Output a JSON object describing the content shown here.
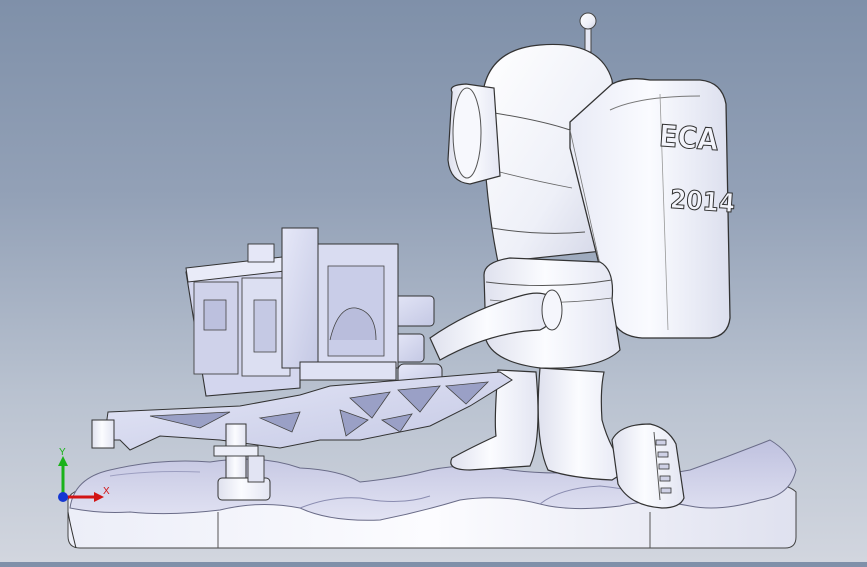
{
  "scene": {
    "backpack_text_top": "ECA",
    "backpack_text_bottom": "2014"
  },
  "triad": {
    "y_label": "Y",
    "x_label": "X",
    "y_color": "#1ab21a",
    "x_color": "#d21414",
    "z_color": "#1437d2"
  },
  "colors": {
    "background_top": "#7f90a9",
    "background_bottom": "#d2d6df",
    "model_white": "#f4f5fb",
    "model_lavender": "#d8dbf1",
    "ground_blue": "#c9cbe6"
  }
}
